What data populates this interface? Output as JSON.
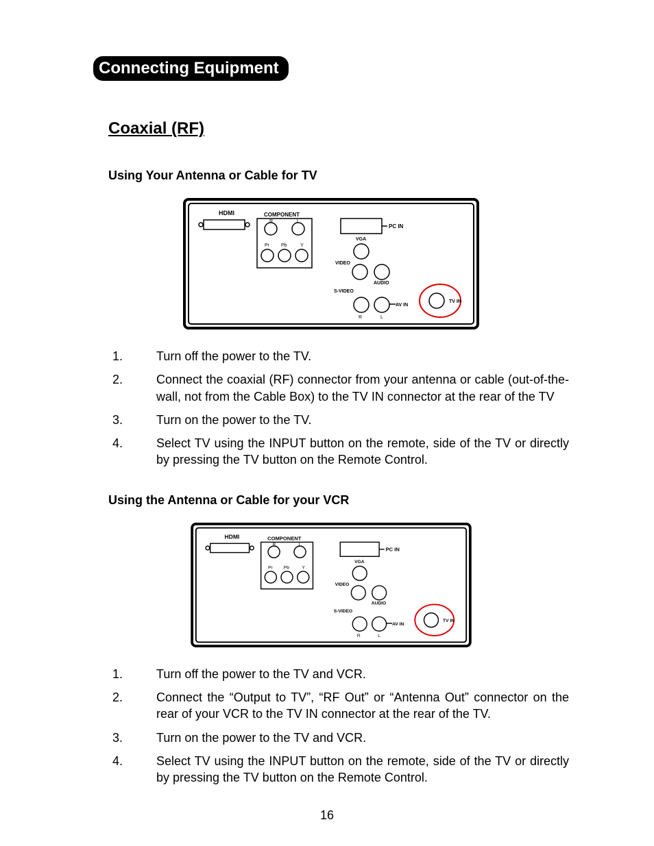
{
  "section_title": "Connecting Equipment",
  "subsection_title": "Coaxial (RF)",
  "tv": {
    "heading": "Using Your Antenna or Cable for TV",
    "step1": "Turn off the power to the TV.",
    "step2": "Connect the coaxial (RF) connector from your antenna or cable (out-of-the-wall, not from the Cable Box) to the TV IN connector at the rear of the TV",
    "step3": "Turn on the power to the TV.",
    "step4": "Select TV using the INPUT button on the remote, side of the TV or directly by pressing the TV button on the Remote Control."
  },
  "vcr": {
    "heading": "Using the Antenna or Cable for your VCR",
    "step1": "Turn off the power to the TV and VCR.",
    "step2": "Connect the “Output to TV”, “RF Out” or “Antenna Out” connector on the rear of your VCR to the TV IN connector at the rear of the TV.",
    "step3": "Turn on the power to the TV and VCR.",
    "step4": "Select TV using the INPUT button on the remote, side of the TV or directly by pressing the TV button on the Remote Control."
  },
  "diagram_labels": {
    "hdmi": "HDMI",
    "component": "COMPONENT",
    "pc_in": "PC IN",
    "vga": "VGA",
    "video": "VIDEO",
    "audio": "AUDIO",
    "svideo": "S-VIDEO",
    "av_in": "AV IN",
    "tv_in": "TV IN",
    "r": "R",
    "l": "L",
    "pr": "Pr",
    "pb": "Pb",
    "y": "Y"
  },
  "page_number": "16"
}
